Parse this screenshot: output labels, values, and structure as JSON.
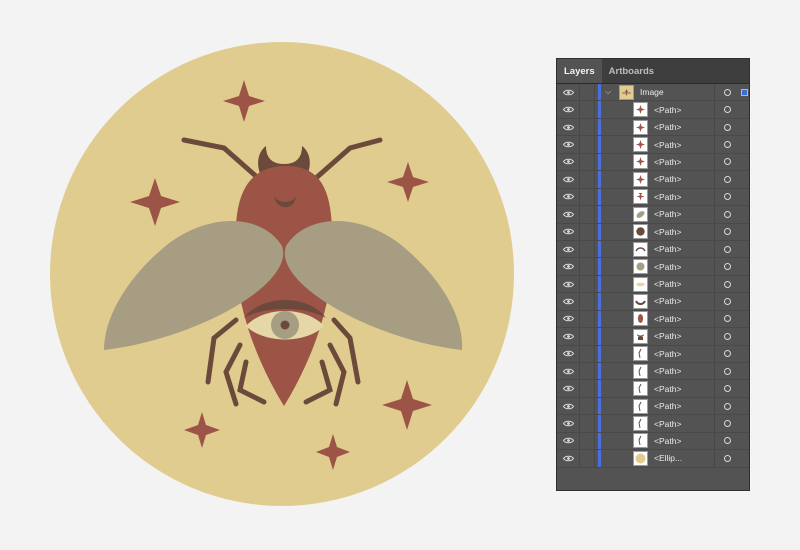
{
  "panel": {
    "tabs": [
      {
        "label": "Layers",
        "active": true
      },
      {
        "label": "Artboards",
        "active": false
      }
    ],
    "layer": {
      "name": "Image",
      "expanded": true,
      "color": "#4c6fe0",
      "selected": true,
      "thumbnail_icon": "illustration-thumbnail-icon"
    },
    "items": [
      {
        "label": "<Path>",
        "thumbnail": "star"
      },
      {
        "label": "<Path>",
        "thumbnail": "star"
      },
      {
        "label": "<Path>",
        "thumbnail": "star"
      },
      {
        "label": "<Path>",
        "thumbnail": "star"
      },
      {
        "label": "<Path>",
        "thumbnail": "star"
      },
      {
        "label": "<Path>",
        "thumbnail": "star-moon"
      },
      {
        "label": "<Path>",
        "thumbnail": "wing"
      },
      {
        "label": "<Path>",
        "thumbnail": "head"
      },
      {
        "label": "<Path>",
        "thumbnail": "arc"
      },
      {
        "label": "<Path>",
        "thumbnail": "iris"
      },
      {
        "label": "<Path>",
        "thumbnail": "eye-shape"
      },
      {
        "label": "<Path>",
        "thumbnail": "eyelid"
      },
      {
        "label": "<Path>",
        "thumbnail": "body"
      },
      {
        "label": "<Path>",
        "thumbnail": "horns"
      },
      {
        "label": "<Path>",
        "thumbnail": "leg"
      },
      {
        "label": "<Path>",
        "thumbnail": "leg"
      },
      {
        "label": "<Path>",
        "thumbnail": "leg"
      },
      {
        "label": "<Path>",
        "thumbnail": "leg"
      },
      {
        "label": "<Path>",
        "thumbnail": "leg"
      },
      {
        "label": "<Path>",
        "thumbnail": "leg"
      },
      {
        "label": "<Ellip...",
        "thumbnail": "ellipse"
      }
    ]
  },
  "colors": {
    "circle": "#e1cc8f",
    "body": "#9c5446",
    "wing": "#a69d82",
    "dark": "#6b4a3c",
    "star": "#9c5446",
    "eye_white": "#e6d7a6",
    "iris": "#a69d82",
    "pupil": "#6b4a3c",
    "panel_bg": "#535353",
    "selection": "#4c6fe0"
  }
}
